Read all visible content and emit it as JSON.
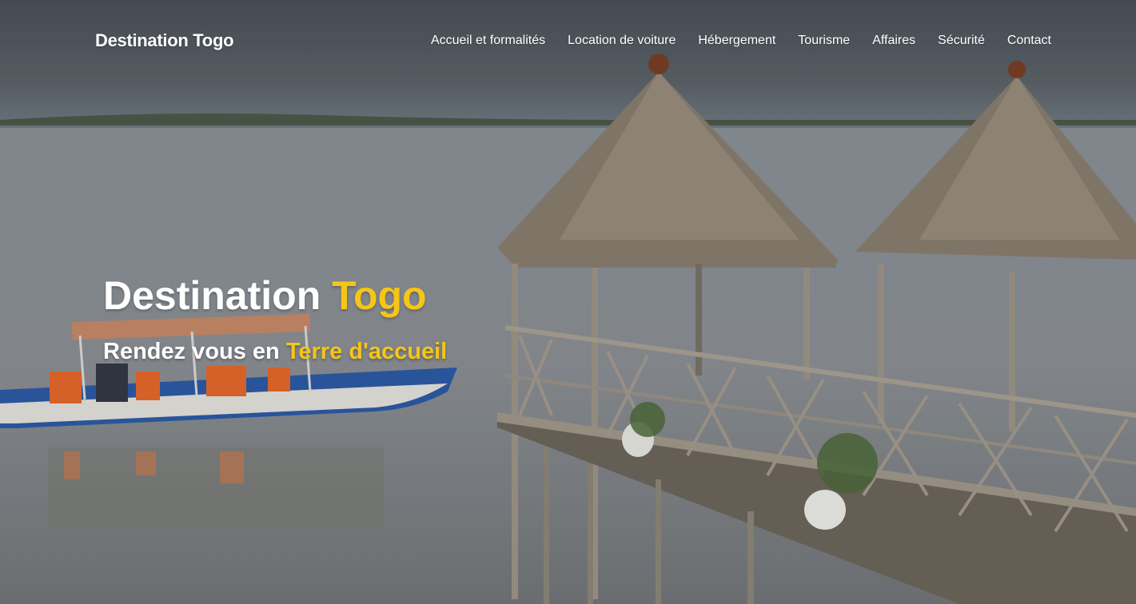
{
  "header": {
    "brand": "Destination Togo",
    "nav": [
      {
        "label": "Accueil et formalités"
      },
      {
        "label": "Location de voiture"
      },
      {
        "label": "Hébergement"
      },
      {
        "label": "Tourisme"
      },
      {
        "label": "Affaires"
      },
      {
        "label": "Sécurité"
      },
      {
        "label": "Contact"
      }
    ]
  },
  "hero": {
    "title_part1": "Destination ",
    "title_part2": "Togo",
    "subtitle_part1": "Rendez vous en ",
    "subtitle_part2": "Terre d'accueil"
  },
  "colors": {
    "accent": "#f5c518",
    "text": "#ffffff"
  }
}
